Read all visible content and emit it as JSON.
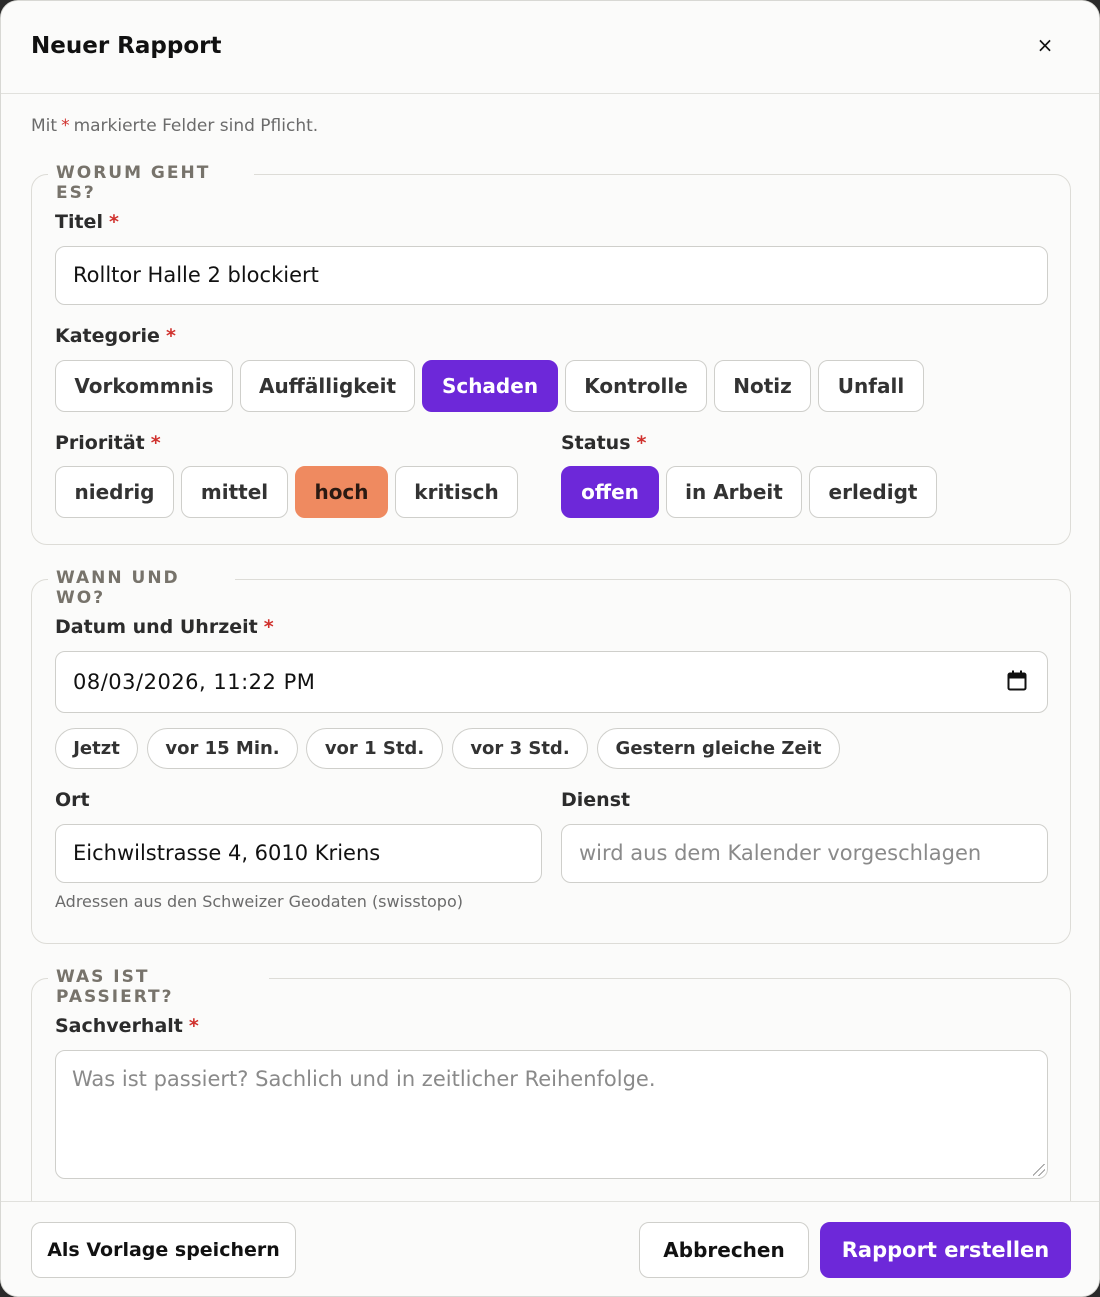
{
  "dialog": {
    "title": "Neuer Rapport",
    "close_icon": "×"
  },
  "hint": {
    "prefix": "Mit",
    "star": "*",
    "suffix": "markierte Felder sind Pflicht."
  },
  "section_what": {
    "legend": "WORUM GEHT ES?",
    "title_label": "Titel",
    "title_value": "Rolltor Halle 2 blockiert",
    "category_label": "Kategorie",
    "categories": [
      "Vorkommnis",
      "Auffälligkeit",
      "Schaden",
      "Kontrolle",
      "Notiz",
      "Unfall"
    ],
    "category_selected": "Schaden",
    "priority_label": "Priorität",
    "priorities": [
      "niedrig",
      "mittel",
      "hoch",
      "kritisch"
    ],
    "priority_selected": "hoch",
    "status_label": "Status",
    "statuses": [
      "offen",
      "in Arbeit",
      "erledigt"
    ],
    "status_selected": "offen"
  },
  "section_when": {
    "legend": "WANN UND WO?",
    "datetime_label": "Datum und Uhrzeit",
    "datetime_value": "08/03/2026, 11:22 PM",
    "quick_times": [
      "Jetzt",
      "vor 15 Min.",
      "vor 1 Std.",
      "vor 3 Std.",
      "Gestern gleiche Zeit"
    ],
    "location_label": "Ort",
    "location_value": "Eichwilstrasse 4, 6010 Kriens",
    "location_note": "Adressen aus den Schweizer Geodaten (swisstopo)",
    "service_label": "Dienst",
    "service_placeholder": "wird aus dem Kalender vorgeschlagen"
  },
  "section_happened": {
    "legend": "WAS IST PASSIERT?",
    "facts_label": "Sachverhalt",
    "facts_placeholder": "Was ist passiert? Sachlich und in zeitlicher Reihenfolge."
  },
  "footer": {
    "save_template": "Als Vorlage speichern",
    "cancel": "Abbrechen",
    "create": "Rapport erstellen"
  },
  "required_star": "*",
  "colors": {
    "accent": "#6d28d9",
    "priority_high": "#ef8a60",
    "required": "#d0312d"
  }
}
